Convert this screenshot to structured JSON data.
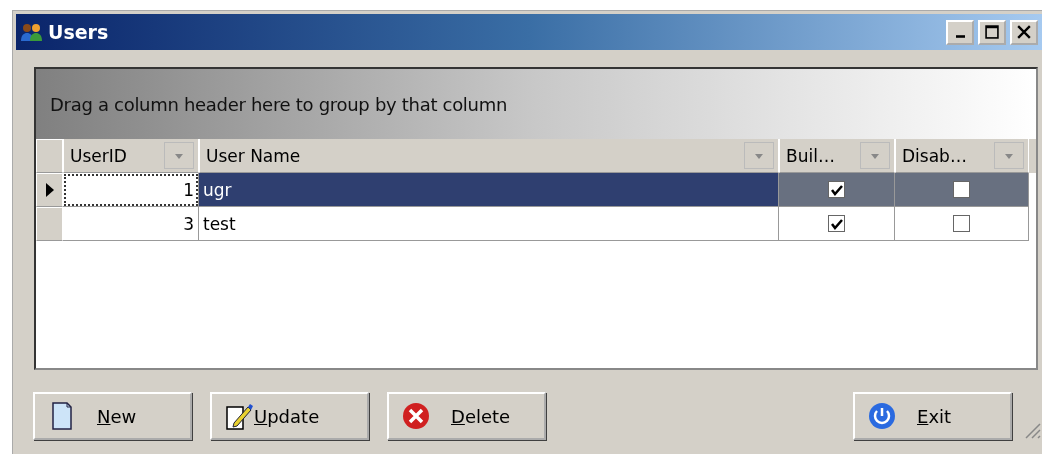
{
  "window": {
    "title": "Users"
  },
  "grid": {
    "group_panel": "Drag a column header here to group by that column",
    "columns": [
      {
        "label": "UserID",
        "kind": "number"
      },
      {
        "label": "User Name",
        "kind": "text"
      },
      {
        "label": "Buil…",
        "kind": "check"
      },
      {
        "label": "Disab…",
        "kind": "check"
      }
    ],
    "rows": [
      {
        "selected": true,
        "cells": [
          "1",
          "ugr",
          true,
          false
        ]
      },
      {
        "selected": false,
        "cells": [
          "3",
          "test",
          true,
          false
        ]
      }
    ]
  },
  "buttons": [
    {
      "label": "New",
      "kind": "new"
    },
    {
      "label": "Update",
      "kind": "update"
    },
    {
      "label": "Delete",
      "kind": "delete"
    },
    {
      "label": "Exit",
      "kind": "exit"
    }
  ]
}
